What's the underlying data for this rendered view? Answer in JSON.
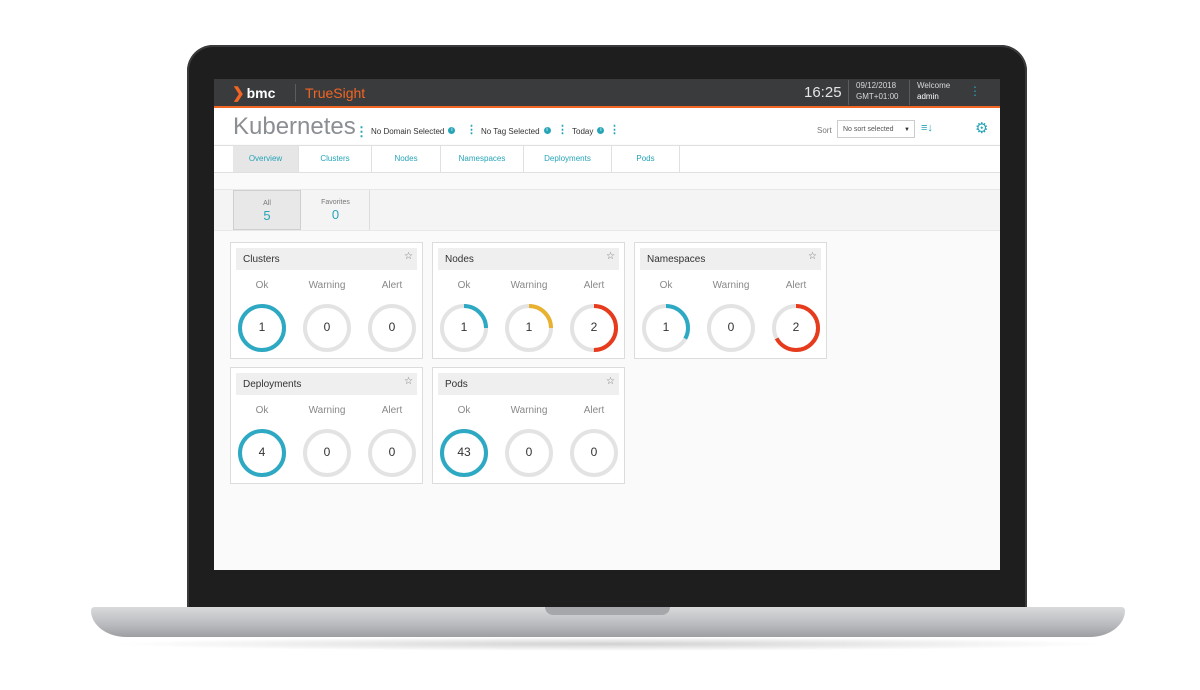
{
  "topbar": {
    "logo": "bmc",
    "brand": "TrueSight",
    "time": "16:25",
    "date": "09/12/2018",
    "timezone": "GMT+01:00",
    "welcome_label": "Welcome",
    "user": "admin"
  },
  "header": {
    "title": "Kubernetes",
    "domain_filter": "No Domain Selected",
    "tag_filter": "No Tag Selected",
    "time_filter": "Today",
    "sort_label": "Sort",
    "sort_value": "No sort selected"
  },
  "tabs": [
    {
      "label": "Overview",
      "active": true
    },
    {
      "label": "Clusters",
      "active": false
    },
    {
      "label": "Nodes",
      "active": false
    },
    {
      "label": "Namespaces",
      "active": false
    },
    {
      "label": "Deployments",
      "active": false
    },
    {
      "label": "Pods",
      "active": false
    }
  ],
  "favorites": [
    {
      "label": "All",
      "count": "5",
      "active": true
    },
    {
      "label": "Favorites",
      "count": "0",
      "active": false
    }
  ],
  "status_labels": {
    "ok": "Ok",
    "warning": "Warning",
    "alert": "Alert"
  },
  "colors": {
    "ok": "#2ea9c3",
    "warning": "#e8b230",
    "alert": "#e63b1c",
    "track": "#e3e3e3",
    "accent": "#f26522"
  },
  "cards": [
    {
      "title": "Clusters",
      "ok": {
        "value": "1",
        "fill": 1.0
      },
      "warning": {
        "value": "0",
        "fill": 0
      },
      "alert": {
        "value": "0",
        "fill": 0
      }
    },
    {
      "title": "Nodes",
      "ok": {
        "value": "1",
        "fill": 0.25
      },
      "warning": {
        "value": "1",
        "fill": 0.25
      },
      "alert": {
        "value": "2",
        "fill": 0.5
      }
    },
    {
      "title": "Namespaces",
      "ok": {
        "value": "1",
        "fill": 0.33
      },
      "warning": {
        "value": "0",
        "fill": 0
      },
      "alert": {
        "value": "2",
        "fill": 0.67
      }
    },
    {
      "title": "Deployments",
      "ok": {
        "value": "4",
        "fill": 1.0
      },
      "warning": {
        "value": "0",
        "fill": 0
      },
      "alert": {
        "value": "0",
        "fill": 0
      }
    },
    {
      "title": "Pods",
      "ok": {
        "value": "43",
        "fill": 1.0
      },
      "warning": {
        "value": "0",
        "fill": 0
      },
      "alert": {
        "value": "0",
        "fill": 0
      }
    }
  ]
}
